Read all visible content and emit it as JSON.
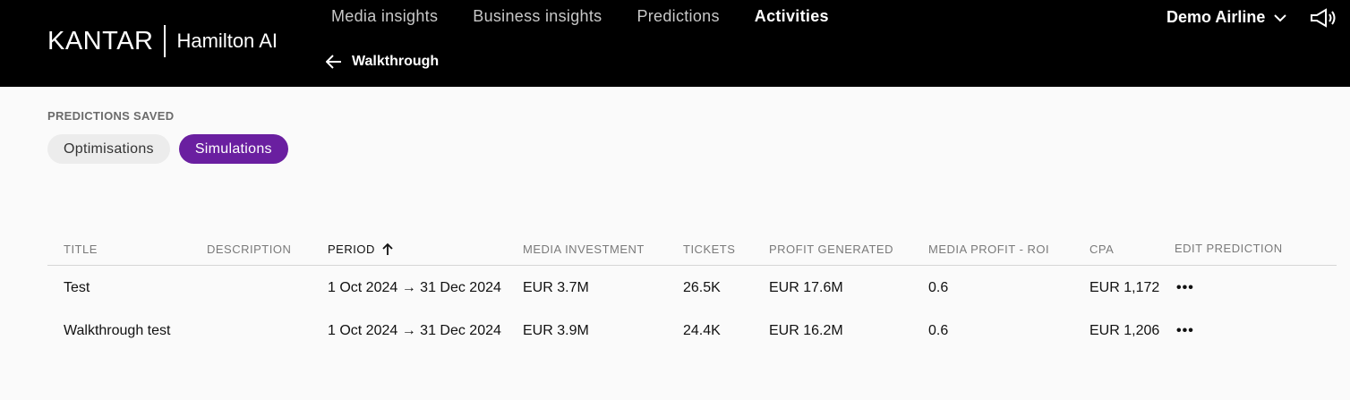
{
  "header": {
    "brand": "KANTAR",
    "product": "Hamilton AI",
    "nav": [
      {
        "label": "Media insights",
        "active": false
      },
      {
        "label": "Business insights",
        "active": false
      },
      {
        "label": "Predictions",
        "active": false
      },
      {
        "label": "Activities",
        "active": true
      }
    ],
    "back_label": "Walkthrough",
    "account": "Demo Airline",
    "icons": {
      "back": "arrow-left-icon",
      "account": "chevron-down-icon",
      "notifications": "megaphone-icon"
    }
  },
  "main": {
    "section_label": "PREDICTIONS SAVED",
    "tabs": [
      {
        "label": "Optimisations",
        "active": false
      },
      {
        "label": "Simulations",
        "active": true
      }
    ],
    "accent_color": "#6a1fa0"
  },
  "table": {
    "columns": [
      "TITLE",
      "DESCRIPTION",
      "PERIOD",
      "MEDIA INVESTMENT",
      "TICKETS",
      "PROFIT GENERATED",
      "MEDIA PROFIT - ROI",
      "CPA",
      "EDIT PREDICTION"
    ],
    "sort": {
      "column": "PERIOD",
      "direction": "ascending",
      "icon": "arrow-up-icon"
    },
    "rows": [
      {
        "title": "Test",
        "description": "",
        "period": "1 Oct 2024 → 31 Dec 2024",
        "media_investment": "EUR 3.7M",
        "tickets": "26.5K",
        "profit_generated": "EUR 17.6M",
        "roi": "0.6",
        "cpa": "EUR 1,172",
        "edit": "•••"
      },
      {
        "title": "Walkthrough test",
        "description": "",
        "period": "1 Oct 2024 → 31 Dec 2024",
        "media_investment": "EUR 3.9M",
        "tickets": "24.4K",
        "profit_generated": "EUR 16.2M",
        "roi": "0.6",
        "cpa": "EUR 1,206",
        "edit": "•••"
      }
    ]
  }
}
